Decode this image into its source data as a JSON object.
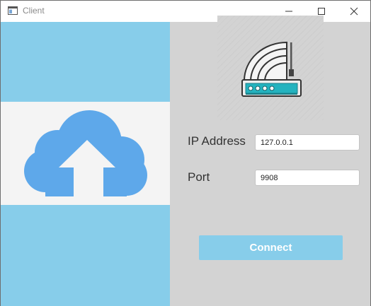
{
  "window": {
    "title": "Client",
    "controls": [
      "minimize",
      "maximize",
      "close"
    ]
  },
  "form": {
    "ip_label": "IP Address",
    "ip_value": "127.0.0.1",
    "port_label": "Port",
    "port_value": "9908",
    "connect_label": "Connect"
  },
  "icons": {
    "left_pane": "cloud-upload-icon",
    "right_pane": "router-icon"
  },
  "colors": {
    "accent": "#87cdea",
    "cloud": "#5ea8ea",
    "panel_gray": "#d3d3d3",
    "router_teal": "#24b3bf"
  }
}
